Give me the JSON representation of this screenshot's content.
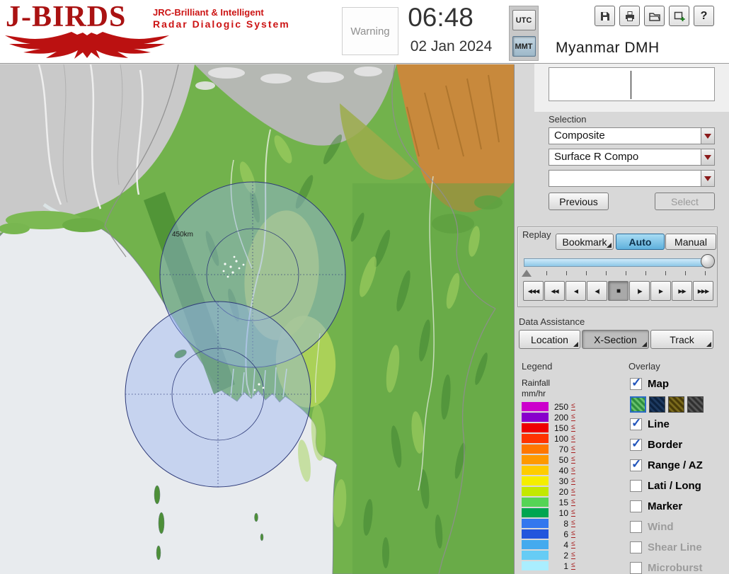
{
  "header": {
    "logo": {
      "title": "J-BIRDS",
      "tagline_line1": "JRC-Brilliant & Intelligent",
      "tagline_line2": "Radar  Dialogic  System"
    },
    "warning_label": "Warning",
    "clock": {
      "time": "06:48",
      "date": "02 Jan 2024"
    },
    "timezone_buttons": [
      {
        "label": "UTC",
        "selected": false
      },
      {
        "label": "MMT",
        "selected": true
      }
    ],
    "site_name": "Myanmar DMH",
    "toolbar_icons": [
      "save-icon",
      "print-icon",
      "open-folder-icon",
      "new-window-icon",
      "help-icon"
    ],
    "help_glyph": "?"
  },
  "status_display": {
    "value": ""
  },
  "selection_panel": {
    "label": "Selection",
    "dropdown1": "Composite",
    "dropdown2": "Surface R Compo",
    "dropdown3": "",
    "previous_button": "Previous",
    "select_button": "Select"
  },
  "replay_panel": {
    "label": "Replay",
    "bookmark_button": "Bookmark",
    "auto_button": "Auto",
    "manual_button": "Manual",
    "playback_buttons": [
      "◀◀◀",
      "◀◀",
      "◀",
      "◀|",
      "■",
      "|▶",
      "▶",
      "▶▶",
      "▶▶▶"
    ]
  },
  "data_assistance": {
    "label": "Data Assistance",
    "buttons": [
      "Location",
      "X-Section",
      "Track"
    ]
  },
  "legend": {
    "label": "Legend",
    "unit_line1": "Rainfall",
    "unit_line2": "mm/hr",
    "lte_symbol": "≤",
    "rows": [
      {
        "value": "250",
        "color": "#cc00cc"
      },
      {
        "value": "200",
        "color": "#8800cc"
      },
      {
        "value": "150",
        "color": "#ee0000"
      },
      {
        "value": "100",
        "color": "#ff3300"
      },
      {
        "value": "70",
        "color": "#ff7700"
      },
      {
        "value": "50",
        "color": "#ff9900"
      },
      {
        "value": "40",
        "color": "#ffcc00"
      },
      {
        "value": "30",
        "color": "#f5ee00"
      },
      {
        "value": "20",
        "color": "#c3e800"
      },
      {
        "value": "15",
        "color": "#55d455"
      },
      {
        "value": "10",
        "color": "#00a550"
      },
      {
        "value": "8",
        "color": "#3377ee"
      },
      {
        "value": "6",
        "color": "#2255dd"
      },
      {
        "value": "4",
        "color": "#44aaee"
      },
      {
        "value": "2",
        "color": "#66ccf5"
      },
      {
        "value": "1",
        "color": "#aaeeff"
      }
    ]
  },
  "overlay": {
    "label": "Overlay",
    "items": [
      {
        "label": "Map",
        "checked": true,
        "enabled": true
      },
      {
        "label": "Line",
        "checked": true,
        "enabled": true
      },
      {
        "label": "Border",
        "checked": true,
        "enabled": true
      },
      {
        "label": "Range / AZ",
        "checked": true,
        "enabled": true
      },
      {
        "label": "Lati / Long",
        "checked": false,
        "enabled": true
      },
      {
        "label": "Marker",
        "checked": false,
        "enabled": true
      },
      {
        "label": "Wind",
        "checked": false,
        "enabled": false
      },
      {
        "label": "Shear Line",
        "checked": false,
        "enabled": false
      },
      {
        "label": "Microburst",
        "checked": false,
        "enabled": false
      }
    ],
    "map_swatches": [
      {
        "name": "terrain-green",
        "color1": "#2f8f3f",
        "color2": "#67c06b",
        "selected": true
      },
      {
        "name": "dark-navy",
        "color1": "#0c2240",
        "color2": "#1d3a60",
        "selected": false
      },
      {
        "name": "dark-olive",
        "color1": "#4a3c08",
        "color2": "#7a6a1c",
        "selected": false
      },
      {
        "name": "dark-gray",
        "color1": "#303030",
        "color2": "#565656",
        "selected": false
      }
    ]
  },
  "map": {
    "range_ring_label": "450km"
  }
}
